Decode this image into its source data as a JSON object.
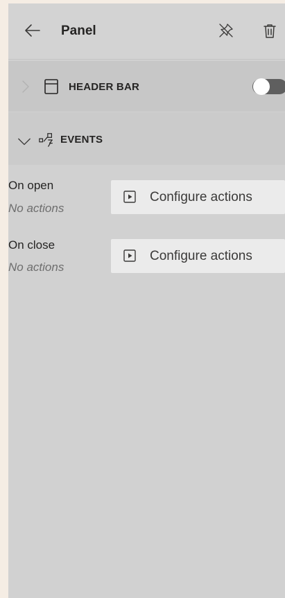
{
  "header": {
    "title": "Panel",
    "back_icon": "arrow-left-icon",
    "unpin_icon": "unpin-icon",
    "delete_icon": "trash-icon"
  },
  "sections": {
    "header_bar": {
      "label": "HEADER BAR",
      "expanded": false,
      "toggle_on": false
    },
    "events": {
      "label": "EVENTS",
      "expanded": true
    }
  },
  "events": [
    {
      "label": "On open",
      "status": "No actions",
      "button_label": "Configure actions"
    },
    {
      "label": "On close",
      "status": "No actions",
      "button_label": "Configure actions"
    }
  ]
}
